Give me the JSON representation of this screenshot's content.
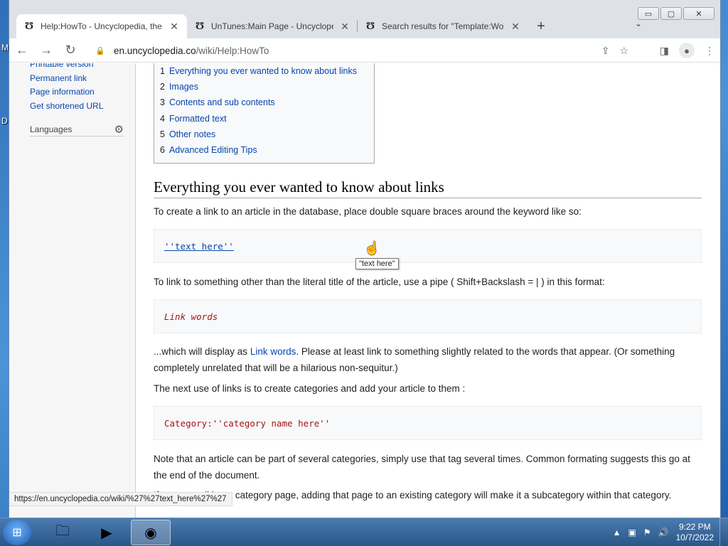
{
  "desktop": {
    "labels": [
      "M",
      "D"
    ]
  },
  "window": {
    "controls": {
      "minimize": "▭",
      "maximize": "▢",
      "close": "✕"
    },
    "tabs": [
      {
        "title": "Help:HowTo - Uncyclopedia, the",
        "favicon": "Ʊ"
      },
      {
        "title": "UnTunes:Main Page - Uncyclope",
        "favicon": "Ʊ"
      },
      {
        "title": "Search results for \"Template:WoW",
        "favicon": "Ʊ"
      }
    ],
    "new_tab": "+",
    "tab_menu": "⌄"
  },
  "toolbar": {
    "back": "←",
    "forward": "→",
    "reload": "↻",
    "lock": "🔒",
    "url_host": "en.uncyclopedia.co",
    "url_path": "/wiki/Help:HowTo",
    "share": "⇪",
    "star": "☆",
    "side_panel": "◨",
    "avatar": "●",
    "menu": "⋮"
  },
  "sidebar": {
    "links": [
      "Printable version",
      "Permanent link",
      "Page information",
      "Get shortened URL"
    ],
    "languages": "Languages",
    "gear": "⚙"
  },
  "toc": [
    {
      "num": "1",
      "text": "Everything you ever wanted to know about links"
    },
    {
      "num": "2",
      "text": "Images"
    },
    {
      "num": "3",
      "text": "Contents and sub contents"
    },
    {
      "num": "4",
      "text": "Formatted text"
    },
    {
      "num": "5",
      "text": "Other notes"
    },
    {
      "num": "6",
      "text": "Advanced Editing Tips"
    }
  ],
  "article": {
    "heading": "Everything you ever wanted to know about links",
    "p1": "To create a link to an article in the database, place double square braces around the keyword like so:",
    "code1": "''text here''",
    "tooltip": "\"text here\"",
    "p2": "To link to something other than the literal title of the article, use a pipe ( Shift+Backslash = | ) in this format:",
    "code2": "Link words",
    "p3_before": "...which will display as ",
    "p3_link": "Link words",
    "p3_after": ". Please at least link to something slightly related to the words that appear. (Or something completely unrelated that will be a hilarious non-sequitur.)",
    "p4": "The next use of links is to create categories and add your article to them :",
    "code3": "Category:''category name here''",
    "p5": "Note that an article can be part of several categories, simply use that tag several times. Common formating suggests this go at the end of the document.",
    "p6": "If you are editing a category page, adding that page to an existing category will make it a subcategory within that category."
  },
  "status_url": "https://en.uncyclopedia.co/wiki/%27%27text_here%27%27",
  "taskbar": {
    "start": "⊞",
    "items": [
      {
        "icon": "🗀"
      },
      {
        "icon": "▶"
      },
      {
        "icon": "◉"
      }
    ],
    "tray_up": "▲",
    "tray_icons": [
      "▣",
      "⚑",
      "🔊"
    ],
    "time": "9:22 PM",
    "date": "10/7/2022"
  },
  "colors": {
    "link": "#0645ad",
    "code": "#a31515",
    "tab_strip": "#dee1e6"
  }
}
